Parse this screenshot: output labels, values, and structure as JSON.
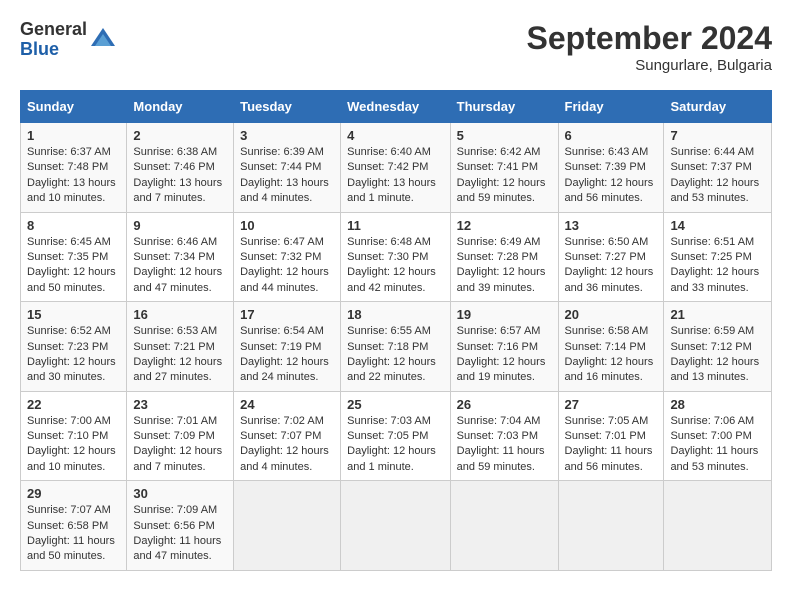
{
  "header": {
    "logo_general": "General",
    "logo_blue": "Blue",
    "title": "September 2024",
    "subtitle": "Sungurlare, Bulgaria"
  },
  "days_of_week": [
    "Sunday",
    "Monday",
    "Tuesday",
    "Wednesday",
    "Thursday",
    "Friday",
    "Saturday"
  ],
  "weeks": [
    [
      {
        "day": "1",
        "sunrise": "6:37 AM",
        "sunset": "7:48 PM",
        "daylight": "13 hours and 10 minutes."
      },
      {
        "day": "2",
        "sunrise": "6:38 AM",
        "sunset": "7:46 PM",
        "daylight": "13 hours and 7 minutes."
      },
      {
        "day": "3",
        "sunrise": "6:39 AM",
        "sunset": "7:44 PM",
        "daylight": "13 hours and 4 minutes."
      },
      {
        "day": "4",
        "sunrise": "6:40 AM",
        "sunset": "7:42 PM",
        "daylight": "13 hours and 1 minute."
      },
      {
        "day": "5",
        "sunrise": "6:42 AM",
        "sunset": "7:41 PM",
        "daylight": "12 hours and 59 minutes."
      },
      {
        "day": "6",
        "sunrise": "6:43 AM",
        "sunset": "7:39 PM",
        "daylight": "12 hours and 56 minutes."
      },
      {
        "day": "7",
        "sunrise": "6:44 AM",
        "sunset": "7:37 PM",
        "daylight": "12 hours and 53 minutes."
      }
    ],
    [
      {
        "day": "8",
        "sunrise": "6:45 AM",
        "sunset": "7:35 PM",
        "daylight": "12 hours and 50 minutes."
      },
      {
        "day": "9",
        "sunrise": "6:46 AM",
        "sunset": "7:34 PM",
        "daylight": "12 hours and 47 minutes."
      },
      {
        "day": "10",
        "sunrise": "6:47 AM",
        "sunset": "7:32 PM",
        "daylight": "12 hours and 44 minutes."
      },
      {
        "day": "11",
        "sunrise": "6:48 AM",
        "sunset": "7:30 PM",
        "daylight": "12 hours and 42 minutes."
      },
      {
        "day": "12",
        "sunrise": "6:49 AM",
        "sunset": "7:28 PM",
        "daylight": "12 hours and 39 minutes."
      },
      {
        "day": "13",
        "sunrise": "6:50 AM",
        "sunset": "7:27 PM",
        "daylight": "12 hours and 36 minutes."
      },
      {
        "day": "14",
        "sunrise": "6:51 AM",
        "sunset": "7:25 PM",
        "daylight": "12 hours and 33 minutes."
      }
    ],
    [
      {
        "day": "15",
        "sunrise": "6:52 AM",
        "sunset": "7:23 PM",
        "daylight": "12 hours and 30 minutes."
      },
      {
        "day": "16",
        "sunrise": "6:53 AM",
        "sunset": "7:21 PM",
        "daylight": "12 hours and 27 minutes."
      },
      {
        "day": "17",
        "sunrise": "6:54 AM",
        "sunset": "7:19 PM",
        "daylight": "12 hours and 24 minutes."
      },
      {
        "day": "18",
        "sunrise": "6:55 AM",
        "sunset": "7:18 PM",
        "daylight": "12 hours and 22 minutes."
      },
      {
        "day": "19",
        "sunrise": "6:57 AM",
        "sunset": "7:16 PM",
        "daylight": "12 hours and 19 minutes."
      },
      {
        "day": "20",
        "sunrise": "6:58 AM",
        "sunset": "7:14 PM",
        "daylight": "12 hours and 16 minutes."
      },
      {
        "day": "21",
        "sunrise": "6:59 AM",
        "sunset": "7:12 PM",
        "daylight": "12 hours and 13 minutes."
      }
    ],
    [
      {
        "day": "22",
        "sunrise": "7:00 AM",
        "sunset": "7:10 PM",
        "daylight": "12 hours and 10 minutes."
      },
      {
        "day": "23",
        "sunrise": "7:01 AM",
        "sunset": "7:09 PM",
        "daylight": "12 hours and 7 minutes."
      },
      {
        "day": "24",
        "sunrise": "7:02 AM",
        "sunset": "7:07 PM",
        "daylight": "12 hours and 4 minutes."
      },
      {
        "day": "25",
        "sunrise": "7:03 AM",
        "sunset": "7:05 PM",
        "daylight": "12 hours and 1 minute."
      },
      {
        "day": "26",
        "sunrise": "7:04 AM",
        "sunset": "7:03 PM",
        "daylight": "11 hours and 59 minutes."
      },
      {
        "day": "27",
        "sunrise": "7:05 AM",
        "sunset": "7:01 PM",
        "daylight": "11 hours and 56 minutes."
      },
      {
        "day": "28",
        "sunrise": "7:06 AM",
        "sunset": "7:00 PM",
        "daylight": "11 hours and 53 minutes."
      }
    ],
    [
      {
        "day": "29",
        "sunrise": "7:07 AM",
        "sunset": "6:58 PM",
        "daylight": "11 hours and 50 minutes."
      },
      {
        "day": "30",
        "sunrise": "7:09 AM",
        "sunset": "6:56 PM",
        "daylight": "11 hours and 47 minutes."
      },
      null,
      null,
      null,
      null,
      null
    ]
  ]
}
